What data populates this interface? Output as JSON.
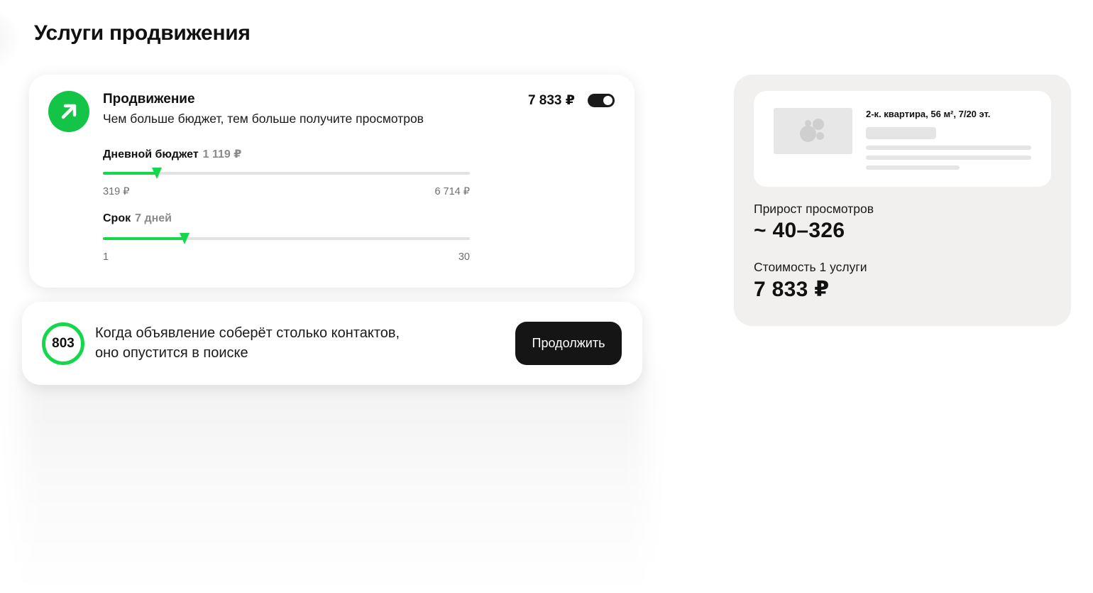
{
  "page": {
    "title": "Услуги продвижения"
  },
  "promotion": {
    "title": "Продвижение",
    "description": "Чем больше бюджет, тем больше получите просмотров",
    "price": "7 833 ₽",
    "enabled": true,
    "accent_color": "#14d74b",
    "icon": "arrow-up-right-icon",
    "daily_budget": {
      "label": "Дневной бюджет",
      "value": "1 119 ₽",
      "min": "319 ₽",
      "max": "6 714 ₽",
      "level": 0.147
    },
    "duration": {
      "label": "Срок",
      "value": "7 дней",
      "min": "1",
      "max": "30",
      "level": 0.223
    }
  },
  "contacts": {
    "count": "803",
    "text_line1": "Когда объявление соберёт столько контактов,",
    "text_line2": "оно опустится в поиске",
    "button_label": "Продолжить"
  },
  "preview": {
    "listing_title": "2-к. квартира, 56 м², 7/20 эт.",
    "views_label": "Прирост просмотров",
    "views_value": "~ 40–326",
    "cost_label": "Стоимость 1 услуги",
    "cost_value": "7 833 ₽"
  }
}
